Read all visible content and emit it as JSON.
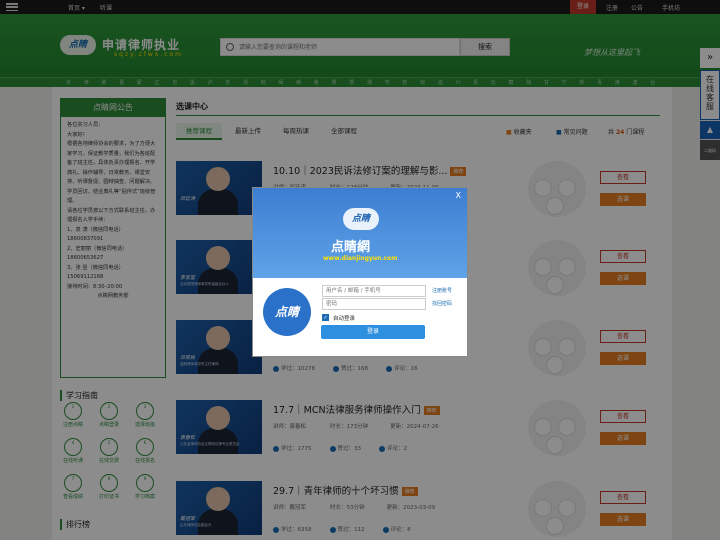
{
  "topbar": {
    "home": "首页 ▾",
    "listen": "听课",
    "login": "登录",
    "register": "注册",
    "notice": "公告",
    "mobile": "手机坊"
  },
  "header": {
    "logo_mark": "点睛",
    "title": "申请律师执业",
    "url": "sqzy.zfwx.com",
    "search_placeholder": "请输入您要查询的课程和老师",
    "search_button": "搜索",
    "slogan": "梦想从这里起飞"
  },
  "categories": [
    "京",
    "津",
    "冀",
    "晋",
    "蒙",
    "辽",
    "吉",
    "黑",
    "沪",
    "苏",
    "浙",
    "皖",
    "闽",
    "赣",
    "鲁",
    "豫",
    "鄂",
    "湘",
    "粤",
    "桂",
    "琼",
    "渝",
    "川",
    "贵",
    "云",
    "藏",
    "陕",
    "甘",
    "宁",
    "新",
    "青",
    "港",
    "澳",
    "台"
  ],
  "sidebar_float": {
    "label": "在线客服",
    "qr": "二维码"
  },
  "notice_box": {
    "title": "点睛网公告",
    "lines": [
      "各位实习人员：",
      "大家好！",
      "根据各地律师协会的要求，为了方便大家学习，保证教学质量，我们为各班配备了班主任，具体负责办理报名、开学典礼、操作辅导、日常教务、课堂安排、听课督促、圆辩抽查、问题解决、学员回访、结业典礼等“贴伴式”班级管理。",
      "请各位学员按以下方式联系班主任，办理报名入学手续：",
      "1、袁 涛（微信同电话）",
      "18600837091",
      "2、史丽丽（微信同电话）",
      "18600653627",
      "3、张 昱（微信同电话）",
      "15069112168",
      "接待时间：8:30–20:00",
      "点睛网教务部"
    ]
  },
  "guide": {
    "title": "学习指南",
    "steps": [
      {
        "num": "1",
        "label": "注册点睛"
      },
      {
        "num": "2",
        "label": "点睛登录"
      },
      {
        "num": "3",
        "label": "选择班级"
      },
      {
        "num": "4",
        "label": "在线听课"
      },
      {
        "num": "5",
        "label": "在线交费"
      },
      {
        "num": "6",
        "label": "在线报名"
      },
      {
        "num": "7",
        "label": "查看成绩"
      },
      {
        "num": "8",
        "label": "打印证书"
      },
      {
        "num": "9",
        "label": "学习档案"
      }
    ]
  },
  "ranking": {
    "title": "排行榜"
  },
  "center": {
    "title": "选课中心",
    "tabs": [
      "推荐课程",
      "最新上传",
      "每周热课",
      "全部课程"
    ],
    "favorites": "收藏夹",
    "faq": "常见问题",
    "count_prefix": "共",
    "count": "24",
    "count_suffix": "门课程"
  },
  "courses": [
    {
      "title": "10.10｜2023民诉法修订案的理解与影...",
      "tag": "推荐",
      "teacher_label": "讲师",
      "teacher": "邓廷涛",
      "duration_label": "时长",
      "duration": "128分钟",
      "date_label": "更新",
      "date": "2023-11-06",
      "learn_label": "学过",
      "learn": "",
      "like_label": "赞过",
      "like": "",
      "comment_label": "评论",
      "comment": "",
      "thumb_name": "邓廷涛",
      "thumb_desc": "",
      "view": "查看",
      "pick": "选课"
    },
    {
      "title": "",
      "tag": "",
      "teacher_label": "",
      "teacher": "",
      "duration_label": "",
      "duration": "",
      "date_label": "",
      "date": "",
      "learn_label": "",
      "learn": "",
      "like_label": "",
      "like": "",
      "comment_label": "",
      "comment": "",
      "thumb_name": "李亚宜",
      "thumb_desc": "北京德恒律师事务所高级合伙人",
      "view": "查看",
      "pick": "选课"
    },
    {
      "title": "",
      "tag": "",
      "teacher_label": "",
      "teacher": "",
      "duration_label": "",
      "duration": "",
      "date_label": "",
      "date": "",
      "learn_label": "学过",
      "learn": "10278",
      "like_label": "赞过",
      "like": "168",
      "comment_label": "评论",
      "comment": "16",
      "thumb_name": "邓梁民",
      "thumb_desc": "金融律师事务所主任律师",
      "view": "查看",
      "pick": "选课"
    },
    {
      "title": "17.7｜MCN法律服务律师操作入门",
      "tag": "推荐",
      "teacher_label": "讲师",
      "teacher": "袁春松",
      "duration_label": "时长",
      "duration": "173分钟",
      "date_label": "更新",
      "date": "2024-07-26",
      "learn_label": "学过",
      "learn": "1775",
      "like_label": "赞过",
      "like": "33",
      "comment_label": "评论",
      "comment": "2",
      "thumb_name": "袁春松",
      "thumb_desc": "江苏省律师协会互联网法律专业委员会",
      "view": "查看",
      "pick": "选课"
    },
    {
      "title": "29.7｜青年律师的十个坏习惯",
      "tag": "推荐",
      "teacher_label": "讲师",
      "teacher": "戴冠军",
      "duration_label": "时长",
      "duration": "53分钟",
      "date_label": "更新",
      "date": "2023-03-09",
      "learn_label": "学过",
      "learn": "6358",
      "like_label": "赞过",
      "like": "112",
      "comment_label": "评论",
      "comment": "8",
      "thumb_name": "戴冠军",
      "thumb_desc": "山东律师协会副会长",
      "view": "查看",
      "pick": "选课"
    }
  ],
  "modal": {
    "close": "X",
    "logo_mark": "点睛",
    "name": "点睛網",
    "url": "www.dianjingyun.com",
    "badge": "点睛",
    "user_placeholder": "用户名 / 邮箱 / 手机号",
    "pass_placeholder": "密码",
    "register_link": "注册账号",
    "forgot_link": "找回密码",
    "auto_login": "自动登录",
    "submit": "登录"
  }
}
